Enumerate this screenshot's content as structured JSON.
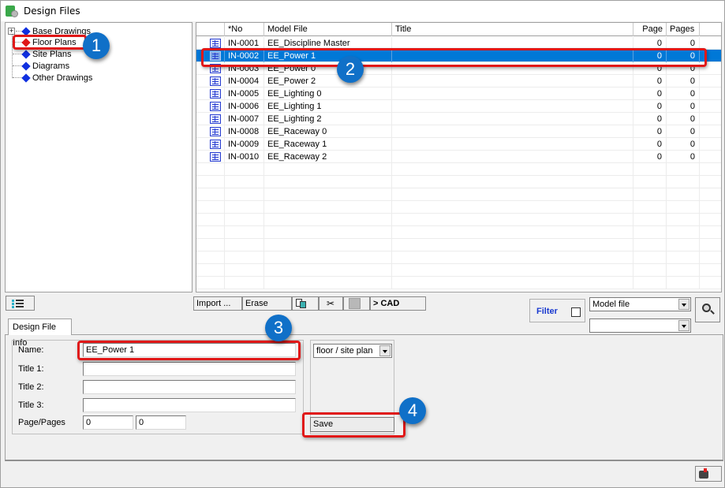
{
  "window": {
    "title": "Design Files"
  },
  "tree": {
    "items": [
      {
        "label": "Base Drawings",
        "color": "#1030e0",
        "expandable": true
      },
      {
        "label": "Floor Plans",
        "color": "#e01818",
        "selected": true
      },
      {
        "label": "Site Plans",
        "color": "#1030e0"
      },
      {
        "label": "Diagrams",
        "color": "#1030e0"
      },
      {
        "label": "Other Drawings",
        "color": "#1030e0"
      }
    ]
  },
  "grid": {
    "columns": [
      "",
      "*No",
      "Model File",
      "Title",
      "Page",
      "Pages"
    ],
    "rows": [
      {
        "no": "IN-0001",
        "model": "EE_Discipline Master",
        "title": "",
        "page": "0",
        "pages": "0"
      },
      {
        "no": "IN-0002",
        "model": "EE_Power 1",
        "title": "",
        "page": "0",
        "pages": "0",
        "selected": true
      },
      {
        "no": "IN-0003",
        "model": "EE_Power 0",
        "title": "",
        "page": "0",
        "pages": "0"
      },
      {
        "no": "IN-0004",
        "model": "EE_Power 2",
        "title": "",
        "page": "0",
        "pages": "0"
      },
      {
        "no": "IN-0005",
        "model": "EE_Lighting 0",
        "title": "",
        "page": "0",
        "pages": "0"
      },
      {
        "no": "IN-0006",
        "model": "EE_Lighting 1",
        "title": "",
        "page": "0",
        "pages": "0"
      },
      {
        "no": "IN-0007",
        "model": "EE_Lighting 2",
        "title": "",
        "page": "0",
        "pages": "0"
      },
      {
        "no": "IN-0008",
        "model": "EE_Raceway 0",
        "title": "",
        "page": "0",
        "pages": "0"
      },
      {
        "no": "IN-0009",
        "model": "EE_Raceway 1",
        "title": "",
        "page": "0",
        "pages": "0"
      },
      {
        "no": "IN-0010",
        "model": "EE_Raceway 2",
        "title": "",
        "page": "0",
        "pages": "0"
      }
    ],
    "selected_color": "#0078d7"
  },
  "toolbar": {
    "import_label": "Import ...",
    "erase_label": "Erase",
    "cad_label": "> CAD",
    "copy_icon": "copy-icon",
    "cut_icon": "scissors-icon",
    "paste_icon": "paste-icon"
  },
  "filter": {
    "label": "Filter",
    "checked": false,
    "field_select": "Model file",
    "value_select": ""
  },
  "tabs": [
    {
      "label": "Design File Info",
      "active": true
    }
  ],
  "form": {
    "name_label": "Name:",
    "name_value": "EE_Power 1",
    "title1_label": "Title 1:",
    "title1_value": "",
    "title2_label": "Title 2:",
    "title2_value": "",
    "title3_label": "Title 3:",
    "title3_value": "",
    "pages_label": "Page/Pages",
    "page_value": "0",
    "pages_value": "0",
    "type_select": "floor / site plan",
    "save_label": "Save"
  },
  "callouts": [
    "1",
    "2",
    "3",
    "4"
  ],
  "colors": {
    "callout": "#1070c8",
    "highlight": "#e01818",
    "filter_text": "#1a3ad0"
  }
}
